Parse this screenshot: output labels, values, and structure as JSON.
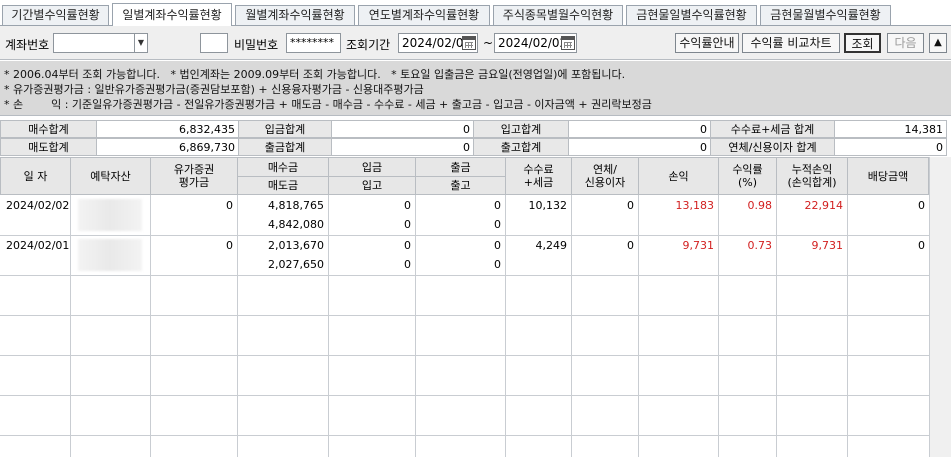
{
  "tabs": [
    {
      "label": "기간별수익률현황",
      "active": false
    },
    {
      "label": "일별계좌수익률현황",
      "active": true
    },
    {
      "label": "월별계좌수익률현황",
      "active": false
    },
    {
      "label": "연도별계좌수익률현황",
      "active": false
    },
    {
      "label": "주식종목별월수익현황",
      "active": false
    },
    {
      "label": "금현물일별수익률현황",
      "active": false
    },
    {
      "label": "금현물월별수익률현황",
      "active": false
    }
  ],
  "search": {
    "account_label": "계좌번호",
    "password_label": "비밀번호",
    "password_value": "********",
    "period_label": "조회기간",
    "date_from": "2024/02/01",
    "date_tilde": "~",
    "date_to": "2024/02/02",
    "btn_guide": "수익률안내",
    "btn_chart": "수익률 비교차트",
    "btn_search": "조회",
    "btn_next": "다음",
    "btn_up": "▲",
    "dropdown_glyph": "▼"
  },
  "notice": [
    "* 2006.04부터 조회 가능합니다.   * 법인계좌는 2009.09부터 조회 가능합니다.   * 토요일 입출금은 금요일(전영업일)에 포함됩니다.",
    "* 유가증권평가금 : 일반유가증권평가금(증권담보포함) + 신용융자평가금 - 신용대주평가금",
    "* 손        익 : 기준일유가증권평가금 - 전일유가증권평가금 + 매도금 - 매수금 - 수수료 - 세금 + 출고금 - 입고금 - 이자금액 + 권리락보정금"
  ],
  "summary": {
    "buy_total_label": "매수합계",
    "buy_total": "6,832,435",
    "deposit_total_label": "입금합계",
    "deposit_total": "0",
    "stock_in_total_label": "입고합계",
    "stock_in_total": "0",
    "fee_tax_total_label": "수수료+세금 합계",
    "fee_tax_total": "14,381",
    "sell_total_label": "매도합계",
    "sell_total": "6,869,730",
    "withdraw_total_label": "출금합계",
    "withdraw_total": "0",
    "stock_out_total_label": "출고합계",
    "stock_out_total": "0",
    "interest_total_label": "연체/신용이자 합계",
    "interest_total": "0"
  },
  "grid": {
    "headers": {
      "date": "일 자",
      "deposit_asset": "예탁자산",
      "securities_eval": "유가증권\n평가금",
      "buy_amount": "매수금",
      "sell_amount": "매도금",
      "deposit": "입금",
      "stock_in": "입고",
      "withdraw": "출금",
      "stock_out": "출고",
      "fee_tax": "수수료\n+세금",
      "interest": "연체/\n신용이자",
      "pnl": "손익",
      "return_rate": "수익률\n(%)",
      "cum_pnl": "누적손익\n(손익합계)",
      "dividend": "배당금액"
    },
    "rows": [
      {
        "date": "2024/02/02",
        "securities_eval": "0",
        "buy": "4,818,765",
        "sell": "4,842,080",
        "deposit": "0",
        "stock_in": "0",
        "withdraw": "0",
        "stock_out": "0",
        "fee_tax": "10,132",
        "interest": "0",
        "pnl": "13,183",
        "return_rate": "0.98",
        "cum_pnl": "22,914",
        "dividend": "0"
      },
      {
        "date": "2024/02/01",
        "securities_eval": "0",
        "buy": "2,013,670",
        "sell": "2,027,650",
        "deposit": "0",
        "stock_in": "0",
        "withdraw": "0",
        "stock_out": "0",
        "fee_tax": "4,249",
        "interest": "0",
        "pnl": "9,731",
        "return_rate": "0.73",
        "cum_pnl": "9,731",
        "dividend": "0"
      }
    ]
  },
  "colors": {
    "profit": "#d21f1f",
    "header_bg": "#e7e7e7",
    "notice_bg": "#d9d9d9"
  }
}
